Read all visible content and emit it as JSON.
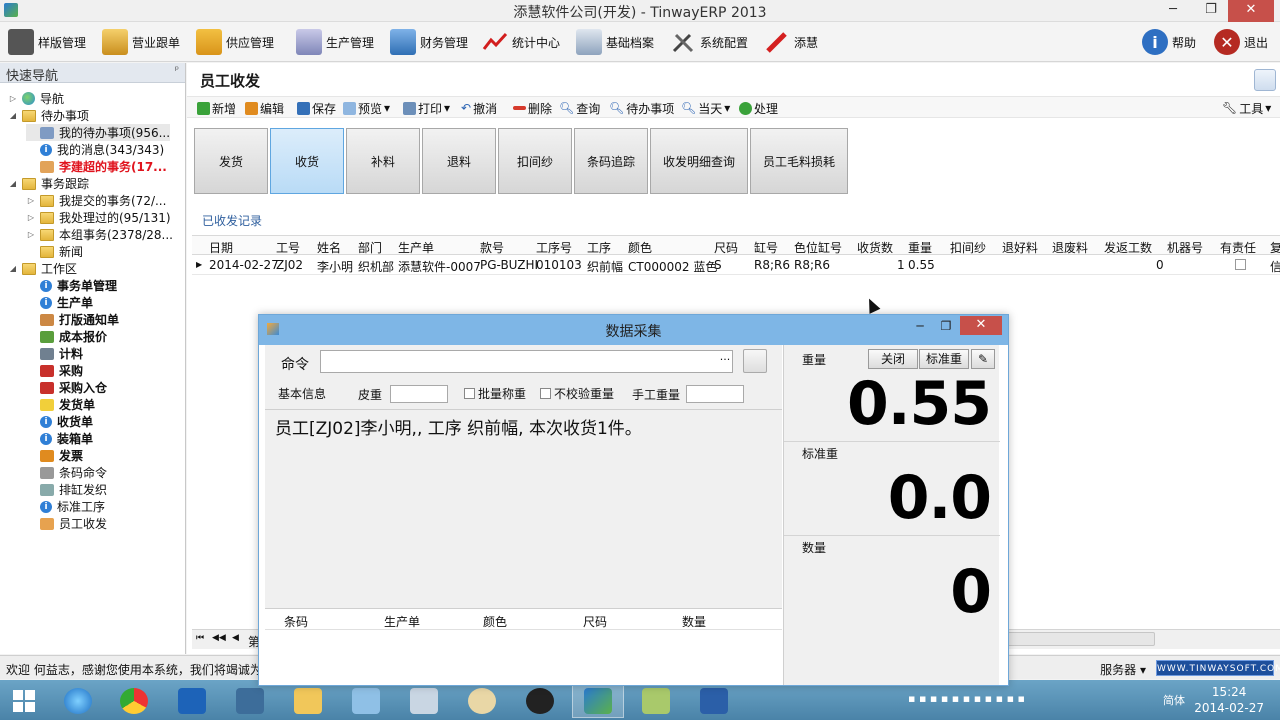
{
  "window": {
    "title": "添慧软件公司(开发) - TinwayERP 2013",
    "minimize": "─",
    "restore": "❐",
    "close": "✕"
  },
  "main_toolbar": {
    "items": [
      "样版管理",
      "营业跟单",
      "供应管理",
      "生产管理",
      "财务管理",
      "统计中心",
      "基础档案",
      "系统配置",
      "添慧"
    ],
    "help": "帮助",
    "exit": "退出"
  },
  "nav": {
    "header": "快速导航",
    "pin": "ᵖ",
    "items": [
      {
        "label": "导航",
        "icon": "globe-icon"
      },
      {
        "label": "待办事项",
        "icon": "folder-icon"
      },
      {
        "label": "我的待办事项(956...",
        "icon": "grid-icon"
      },
      {
        "label": "我的消息(343/343)",
        "icon": "info-icon"
      },
      {
        "label": "李建超的事务(17...",
        "icon": "user-icon"
      },
      {
        "label": "事务跟踪",
        "icon": "folder-icon"
      },
      {
        "label": "我提交的事务(72/...",
        "icon": "folder-icon"
      },
      {
        "label": "我处理过的(95/131)",
        "icon": "folder-icon"
      },
      {
        "label": "本组事务(2378/28...",
        "icon": "folder-icon"
      },
      {
        "label": "新闻",
        "icon": "folder-icon"
      },
      {
        "label": "工作区",
        "icon": "folder-icon"
      },
      {
        "label": "事务单管理",
        "icon": "info-icon"
      },
      {
        "label": "生产单",
        "icon": "info-icon"
      },
      {
        "label": "打版通知单",
        "icon": "brush-icon"
      },
      {
        "label": "成本报价",
        "icon": "cost-icon"
      },
      {
        "label": "计料",
        "icon": "calculator-icon"
      },
      {
        "label": "采购",
        "icon": "cart-icon"
      },
      {
        "label": "采购入仓",
        "icon": "cart-icon"
      },
      {
        "label": "发货单",
        "icon": "note-icon"
      },
      {
        "label": "收货单",
        "icon": "info-icon"
      },
      {
        "label": "装箱单",
        "icon": "info-icon"
      },
      {
        "label": "发票",
        "icon": "at-icon"
      },
      {
        "label": "条码命令",
        "icon": "barcode-icon"
      },
      {
        "label": "排缸发织",
        "icon": "gear-icon"
      },
      {
        "label": "标准工序",
        "icon": "info-icon"
      },
      {
        "label": "员工收发",
        "icon": "users-icon"
      }
    ]
  },
  "page": {
    "title": "员工收发"
  },
  "sec_toolbar": {
    "items": [
      "新增",
      "编辑",
      "保存",
      "预览",
      "打印",
      "撤消",
      "删除",
      "查询",
      "待办事项",
      "当天",
      "处理"
    ],
    "tools": "工具"
  },
  "big_buttons": [
    "发货",
    "收货",
    "补料",
    "退料",
    "扣间纱",
    "条码追踪",
    "收发明细查询",
    "员工毛料损耗"
  ],
  "records_label": "已收发记录",
  "grid": {
    "columns": [
      "日期",
      "工号",
      "姓名",
      "部门",
      "生产单",
      "款号",
      "工序号",
      "工序",
      "颜色",
      "尺码",
      "缸号",
      "色位缸号",
      "收货数",
      "重量",
      "扣间纱",
      "退好料",
      "退废料",
      "发返工数",
      "机器号",
      "有责任",
      "复"
    ],
    "row": [
      "2014-02-27",
      "ZJ02",
      "李小明",
      "织机部",
      "添慧软件-0007",
      "PG-BUZHI",
      "010103",
      "织前幅",
      "CT000002 蓝色",
      "S",
      "R8;R6",
      "R8;R6",
      "1",
      "0.55",
      "",
      "",
      "",
      "0",
      "",
      "",
      "信"
    ]
  },
  "pager": {
    "first": "⏮",
    "prev": "◀◀",
    "back": "◀",
    "text": "第"
  },
  "status": {
    "welcome": "欢迎 何益志，感谢您使用本系统，我们将竭诚为您",
    "server": "服务器 ▾",
    "logo": "WWW.TINWAYSOFT.COM"
  },
  "dialog": {
    "title": "数据采集",
    "command_label": "命令",
    "command_value": "",
    "dots": "···",
    "basic_info": "基本信息",
    "tare_label": "皮重",
    "batch_weigh": "批量称重",
    "no_verify": "不校验重量",
    "manual_weight": "手工重量",
    "message": "员工[ZJ02]李小明,, 工序 织前幅, 本次收货1件。",
    "sub_grid_columns": [
      "条码",
      "生产单",
      "颜色",
      "尺码",
      "数量"
    ],
    "weight_label": "重量",
    "close_btn": "关闭",
    "std_weight_btn": "标准重",
    "weight_value": "0.55",
    "std_weight_label": "标准重",
    "std_weight_value": "0.0",
    "qty_label": "数量",
    "qty_value": "0"
  },
  "taskbar": {
    "clock_time": "15:24",
    "clock_date": "2014-02-27",
    "lang": "简体"
  },
  "colors": {
    "accent": "#5fa6e0",
    "title_bar": "#7eb6e6",
    "close_red": "#c7504a",
    "highlight_red": "#e0141e",
    "taskbar": "#5b94b8"
  }
}
